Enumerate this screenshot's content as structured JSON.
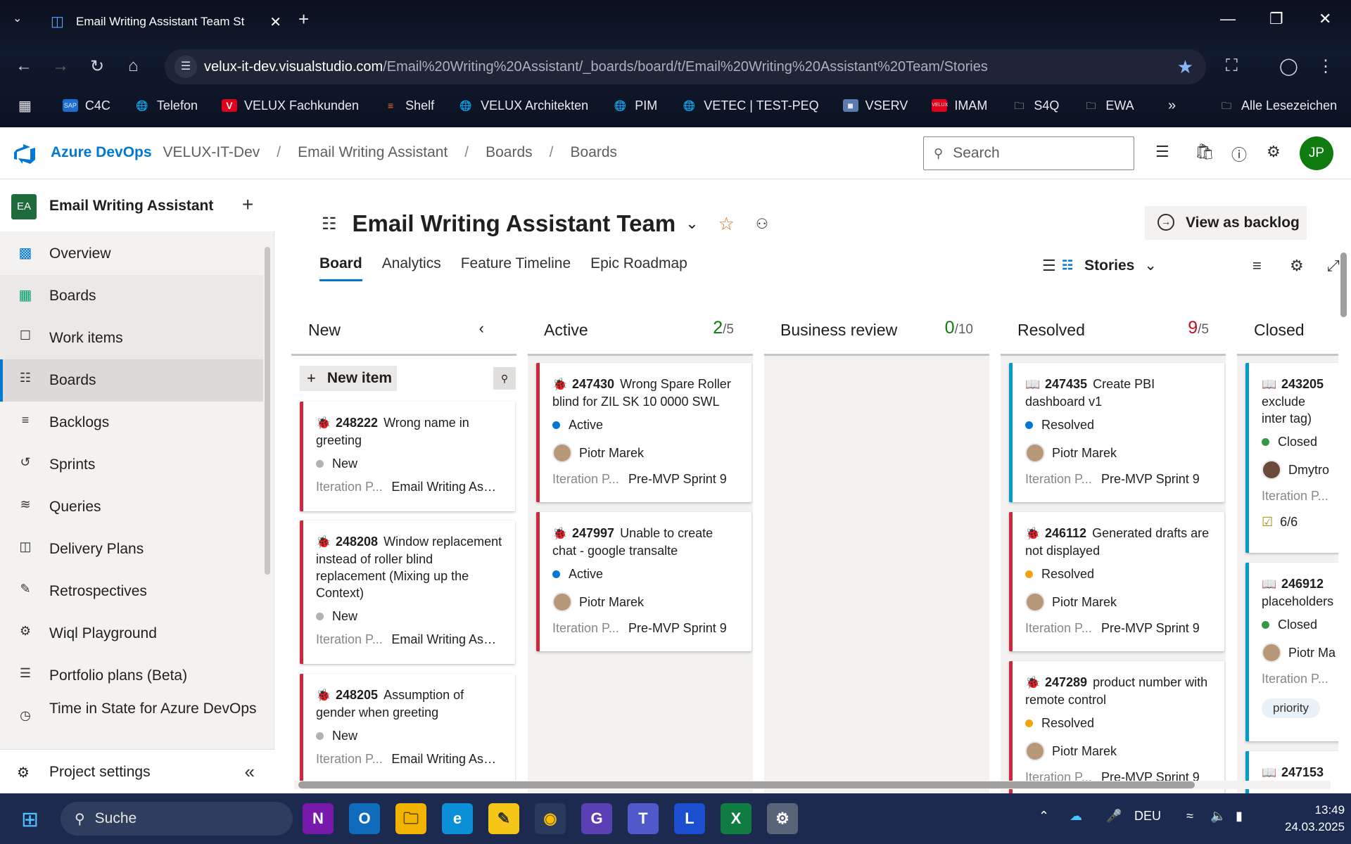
{
  "browser": {
    "tab_title": "Email Writing Assistant Team St",
    "url_host": "velux-it-dev.visualstudio.com",
    "url_path": "/Email%20Writing%20Assistant/_boards/board/t/Email%20Writing%20Assistant%20Team/Stories",
    "bookmarks": [
      "C4C",
      "Telefon",
      "VELUX Fachkunden",
      "Shelf",
      "VELUX Architekten",
      "PIM",
      "VETEC | TEST-PEQ",
      "VSERV",
      "IMAM",
      "S4Q",
      "EWA"
    ],
    "all_bookmarks": "Alle Lesezeichen"
  },
  "header": {
    "brand": "Azure DevOps",
    "crumbs": [
      "VELUX-IT-Dev",
      "Email Writing Assistant",
      "Boards",
      "Boards"
    ],
    "search_placeholder": "Search",
    "avatar": "JP"
  },
  "sidebar": {
    "project_badge": "EA",
    "project_name": "Email Writing Assistant",
    "items": [
      {
        "label": "Overview",
        "icon": "overview-icon"
      },
      {
        "label": "Boards",
        "icon": "boards-hub-icon"
      },
      {
        "label": "Work items",
        "icon": "work-items-icon"
      },
      {
        "label": "Boards",
        "icon": "boards-icon"
      },
      {
        "label": "Backlogs",
        "icon": "backlogs-icon"
      },
      {
        "label": "Sprints",
        "icon": "sprints-icon"
      },
      {
        "label": "Queries",
        "icon": "queries-icon"
      },
      {
        "label": "Delivery Plans",
        "icon": "delivery-plans-icon"
      },
      {
        "label": "Retrospectives",
        "icon": "retrospectives-icon"
      },
      {
        "label": "Wiql Playground",
        "icon": "wiql-icon"
      },
      {
        "label": "Portfolio plans (Beta)",
        "icon": "portfolio-icon"
      },
      {
        "label": "Time in State for Azure DevOps",
        "icon": "time-in-state-icon"
      }
    ],
    "project_settings": "Project settings"
  },
  "main": {
    "team_name": "Email Writing Assistant Team",
    "view_backlog": "View as backlog",
    "pivots": [
      "Board",
      "Analytics",
      "Feature Timeline",
      "Epic Roadmap"
    ],
    "backlog_level": "Stories",
    "new_item": "New item",
    "columns": [
      {
        "name": "New",
        "wip": "",
        "limit": ""
      },
      {
        "name": "Active",
        "wip": "2",
        "limit": "/5"
      },
      {
        "name": "Business review",
        "wip": "0",
        "limit": "/10"
      },
      {
        "name": "Resolved",
        "wip": "9",
        "limit": "/5"
      },
      {
        "name": "Closed",
        "wip": "",
        "limit": ""
      }
    ],
    "iteration_label": "Iteration P...",
    "cards": {
      "new": [
        {
          "id": "248222",
          "title": "Wrong name in greeting",
          "state": "New",
          "iteration": "Email Writing Assi..."
        },
        {
          "id": "248208",
          "title": "Window replacement instead of roller blind replacement (Mixing up the Context)",
          "state": "New",
          "iteration": "Email Writing Assi..."
        },
        {
          "id": "248205",
          "title": "Assumption of gender when greeting",
          "state": "New",
          "iteration": "Email Writing Assi..."
        }
      ],
      "active": [
        {
          "id": "247430",
          "title": "Wrong Spare Roller blind for ZIL SK 10 0000 SWL",
          "state": "Active",
          "assignee": "Piotr Marek",
          "iteration": "Pre-MVP Sprint 9"
        },
        {
          "id": "247997",
          "title": "Unable to create chat - google transalte",
          "state": "Active",
          "assignee": "Piotr Marek",
          "iteration": "Pre-MVP Sprint 9"
        }
      ],
      "resolved": [
        {
          "id": "247435",
          "title": "Create PBI dashboard v1",
          "state": "Resolved",
          "assignee": "Piotr Marek",
          "iteration": "Pre-MVP Sprint 9"
        },
        {
          "id": "246112",
          "title": "Generated drafts are not displayed",
          "state": "Resolved",
          "assignee": "Piotr Marek",
          "iteration": "Pre-MVP Sprint 9"
        },
        {
          "id": "247289",
          "title": "product number with remote control",
          "state": "Resolved",
          "assignee": "Piotr Marek",
          "iteration": "Pre-MVP Sprint 9"
        }
      ],
      "closed": [
        {
          "id": "243205",
          "title": "exclude inter tag)",
          "state": "Closed",
          "assignee": "Dmytro",
          "checklist": "6/6"
        },
        {
          "id": "246912",
          "title": "placeholders",
          "state": "Closed",
          "assignee": "Piotr Ma",
          "tag": "priority"
        },
        {
          "id": "247153",
          "title": ""
        }
      ]
    }
  },
  "taskbar": {
    "search": "Suche",
    "lang": "DEU",
    "time": "13:49",
    "date": "24.03.2025"
  },
  "colors": {
    "accent": "#0078d4",
    "bug": "#cc293d",
    "pbi": "#009ccc",
    "active": "#0078d4",
    "resolved": "#f2a30f",
    "closed": "#339947",
    "new": "#b2b2b2"
  }
}
